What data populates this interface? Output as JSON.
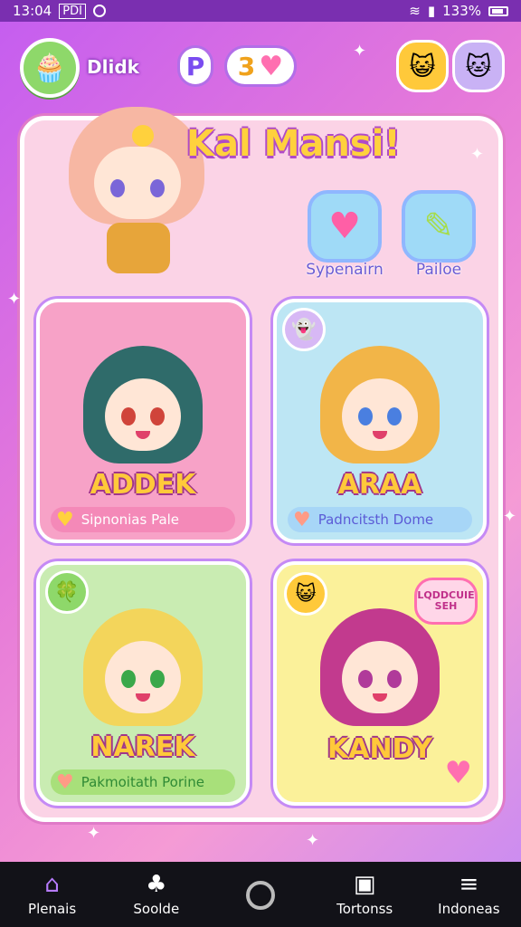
{
  "status_bar": {
    "time": "13:04",
    "left_badge": "PDI",
    "battery_percent": "133%"
  },
  "header": {
    "user_name": "Dlidk",
    "coin_label": "P",
    "hearts_label": "3"
  },
  "board": {
    "title": "Kal Mansi!",
    "shop_buttons": [
      {
        "label": "Sypenairn",
        "icon": "heart-icon"
      },
      {
        "label": "Pailoe",
        "icon": "bottle-icon"
      }
    ],
    "cards": [
      {
        "name": "ADDEK",
        "tag": "Sipnonias Pale",
        "bg": "#f7a2c7"
      },
      {
        "name": "ARAA",
        "tag": "Padncitsth Dome",
        "bg": "#bde6f4"
      },
      {
        "name": "NAREK",
        "tag": "Pakmoitath Porine",
        "bg": "#c9ecb2"
      },
      {
        "name": "KANDY",
        "tag": "",
        "bubble": "LQDDCUIE SEH",
        "bg": "#fbf19a"
      }
    ]
  },
  "bottom_nav": [
    {
      "label": "Plenais",
      "icon": "home-icon"
    },
    {
      "label": "Soolde",
      "icon": "tree-icon"
    },
    {
      "label": "",
      "icon": "circle-icon"
    },
    {
      "label": "Tortonss",
      "icon": "tv-icon"
    },
    {
      "label": "Indoneas",
      "icon": "stack-icon"
    }
  ]
}
